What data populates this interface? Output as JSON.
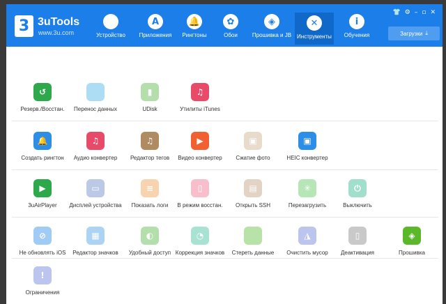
{
  "app": {
    "logo_mark": "3",
    "name": "3uTools",
    "url": "www.3u.com"
  },
  "nav": [
    {
      "label": "Устройство",
      "icon": "apple-icon",
      "glyph": ""
    },
    {
      "label": "Приложения",
      "icon": "app-store-icon",
      "glyph": "A"
    },
    {
      "label": "Рингтоны",
      "icon": "bell-icon",
      "glyph": "🔔"
    },
    {
      "label": "Обои",
      "icon": "flower-icon",
      "glyph": "✿"
    },
    {
      "label": "Прошивка и JB",
      "icon": "box-icon",
      "glyph": "◈"
    },
    {
      "label": "Инструменты",
      "icon": "tools-icon",
      "glyph": "✕",
      "active": true
    },
    {
      "label": "Обучения",
      "icon": "info-icon",
      "glyph": "i"
    }
  ],
  "window_controls": {
    "shirt": "👕",
    "gear": "⚙",
    "minimize": "–",
    "maximize": "▫",
    "close": "✕"
  },
  "downloads": {
    "label": "Загрузки",
    "icon": "download-icon",
    "glyph": "⤓"
  },
  "tools": {
    "row1": [
      {
        "label": "Резерв./Восстан.",
        "icon": "backup-icon",
        "color": "#2da84a",
        "glyph": "↺",
        "faded": false
      },
      {
        "label": "Перенос данных",
        "icon": "transfer-icon",
        "color": "#48b4e6",
        "glyph": "",
        "faded": true
      },
      {
        "label": "UDisk",
        "icon": "usb-icon",
        "color": "#5ab84a",
        "glyph": "▮",
        "faded": true
      },
      {
        "label": "Утилиты iTunes",
        "icon": "music-icon",
        "color": "#e84a6a",
        "glyph": "♫",
        "faded": false
      }
    ],
    "row2": [
      {
        "label": "Создать рингтон",
        "icon": "bell-icon",
        "color": "#2d8ee8",
        "glyph": "🔔",
        "faded": false
      },
      {
        "label": "Аудио конвертер",
        "icon": "audio-icon",
        "color": "#e84a6a",
        "glyph": "♫",
        "faded": false
      },
      {
        "label": "Редактор тегов",
        "icon": "tag-editor-icon",
        "color": "#b08a60",
        "glyph": "♫",
        "faded": false
      },
      {
        "label": "Видео конвертер",
        "icon": "video-icon",
        "color": "#f06030",
        "glyph": "▶",
        "faded": false
      },
      {
        "label": "Сжатие фото",
        "icon": "photo-icon",
        "color": "#d0b090",
        "glyph": "▣",
        "faded": true
      },
      {
        "label": "HEIC конвертер",
        "icon": "heic-icon",
        "color": "#2d8ee8",
        "glyph": "▣",
        "faded": false
      }
    ],
    "row3": [
      {
        "label": "3uAirPlayer",
        "icon": "airplay-icon",
        "color": "#2da84a",
        "glyph": "▶",
        "faded": false
      },
      {
        "label": "Дисплей устройства",
        "icon": "display-icon",
        "color": "#6a8ac8",
        "glyph": "▭",
        "faded": true
      },
      {
        "label": "Показать логи",
        "icon": "logs-icon",
        "color": "#f0a050",
        "glyph": "≡",
        "faded": true
      },
      {
        "label": "В режим восстан.",
        "icon": "recovery-icon",
        "color": "#f07090",
        "glyph": "▯",
        "faded": true
      },
      {
        "label": "Открыть SSH",
        "icon": "ssh-icon",
        "color": "#c0a080",
        "glyph": "▤",
        "faded": true
      },
      {
        "label": "Перезагрузить",
        "icon": "reboot-icon",
        "color": "#60c860",
        "glyph": "✳",
        "faded": true
      },
      {
        "label": "Выключить",
        "icon": "power-icon",
        "color": "#30b890",
        "glyph": "⏻",
        "faded": true
      }
    ],
    "row4": [
      {
        "label": "Не обновлять iOS",
        "icon": "no-update-icon",
        "color": "#2d8ee8",
        "glyph": "⊘",
        "faded": true
      },
      {
        "label": "Редактор значков",
        "icon": "icon-editor-icon",
        "color": "#48a0e8",
        "glyph": "▦",
        "faded": true
      },
      {
        "label": "Удобный доступ",
        "icon": "access-icon",
        "color": "#5ab84a",
        "glyph": "◐",
        "faded": true
      },
      {
        "label": "Коррекция значков",
        "icon": "icon-fix-icon",
        "color": "#40c0a0",
        "glyph": "◔",
        "faded": true
      },
      {
        "label": "Стереть данные",
        "icon": "erase-icon",
        "color": "#60c040",
        "glyph": "",
        "faded": true
      },
      {
        "label": "Очистить мусор",
        "icon": "clean-icon",
        "color": "#6a80d8",
        "glyph": "◮",
        "faded": true
      },
      {
        "label": "Деактивация",
        "icon": "deactivate-icon",
        "color": "#8a8a8a",
        "glyph": "▯",
        "faded": true
      },
      {
        "label": "Прошивка",
        "icon": "firmware-icon",
        "color": "#5ab82a",
        "glyph": "◈",
        "faded": false
      }
    ],
    "row5": [
      {
        "label": "Ограничения",
        "icon": "restrictions-icon",
        "color": "#6a80d8",
        "glyph": "!",
        "faded": true
      }
    ]
  }
}
